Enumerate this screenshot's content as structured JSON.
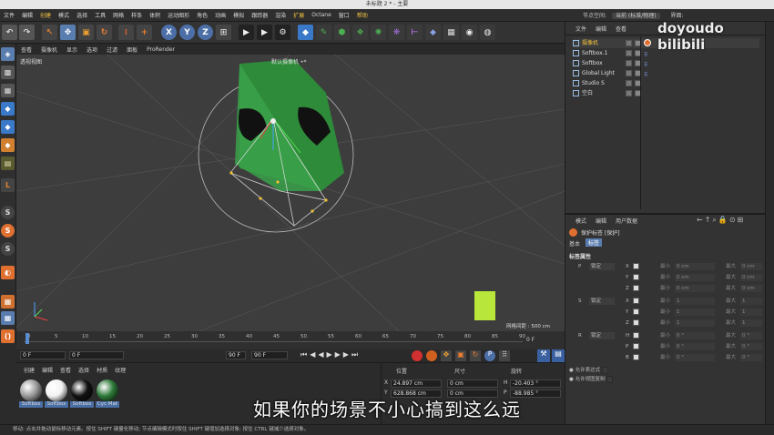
{
  "window": {
    "title": "未标题 2 * - 主要"
  },
  "menu": [
    {
      "label": "文件",
      "hl": false
    },
    {
      "label": "编辑",
      "hl": false
    },
    {
      "label": "创建",
      "hl": true
    },
    {
      "label": "模式",
      "hl": false
    },
    {
      "label": "选择",
      "hl": false
    },
    {
      "label": "工具",
      "hl": false
    },
    {
      "label": "网格",
      "hl": false
    },
    {
      "label": "样条",
      "hl": false
    },
    {
      "label": "体积",
      "hl": false
    },
    {
      "label": "运动图形",
      "hl": false
    },
    {
      "label": "角色",
      "hl": false
    },
    {
      "label": "动画",
      "hl": false
    },
    {
      "label": "模拟",
      "hl": false
    },
    {
      "label": "跟踪器",
      "hl": false
    },
    {
      "label": "渲染",
      "hl": false
    },
    {
      "label": "扩展",
      "hl": true
    },
    {
      "label": "Octane",
      "hl": false
    },
    {
      "label": "窗口",
      "hl": false
    },
    {
      "label": "帮助",
      "hl": true
    }
  ],
  "node_space": {
    "label": "节点空间:",
    "value": "当前 (标准/物理)",
    "layout_label": "界面:"
  },
  "toolbar": {
    "axis_x": "X",
    "axis_y": "Y",
    "axis_z": "Z"
  },
  "viewport_menu": [
    "查看",
    "摄像机",
    "显示",
    "选项",
    "过滤",
    "面板",
    "ProRender"
  ],
  "viewport": {
    "view_name": "透视视图",
    "camera_label": "默认摄像机 •*",
    "grid_spacing": "网格间距 : 500 cm"
  },
  "timeline": {
    "ticks": [
      "0",
      "5",
      "10",
      "15",
      "20",
      "25",
      "30",
      "35",
      "40",
      "45",
      "50",
      "55",
      "60",
      "65",
      "70",
      "75",
      "80",
      "85",
      "90"
    ],
    "end_frame": "0 F"
  },
  "transport": {
    "current": "0 F",
    "start": "0 F",
    "end": "90 F",
    "end2": "90 F"
  },
  "materials": {
    "menu": [
      "创建",
      "编辑",
      "查看",
      "选择",
      "材质",
      "纹理"
    ],
    "items": [
      {
        "name": "Softbox",
        "color": "#9a9a9a"
      },
      {
        "name": "Softbox",
        "color": "#f2f2f2"
      },
      {
        "name": "Softbox",
        "color": "#111111"
      },
      {
        "name": "Cyc Mat",
        "color": "#2f7a3a"
      }
    ]
  },
  "coords": {
    "headers": [
      "位置",
      "尺寸",
      "旋转"
    ],
    "rows": [
      {
        "axis": "X",
        "pos": "24.897 cm",
        "size": "0 cm",
        "rot_label": "H",
        "rot": "-20.403 °"
      },
      {
        "axis": "Y",
        "pos": "628.868 cm",
        "size": "0 cm",
        "rot_label": "P",
        "rot": "-88.985 °"
      }
    ]
  },
  "objects": {
    "menu": [
      "文件",
      "编辑",
      "查看"
    ],
    "items": [
      {
        "name": "摄像机",
        "selected": true
      },
      {
        "name": "Softbox.1",
        "selected": false
      },
      {
        "name": "Softbox",
        "selected": false
      },
      {
        "name": "Global Light",
        "selected": false
      },
      {
        "name": "Studio S",
        "selected": false
      },
      {
        "name": "空白",
        "selected": false
      }
    ]
  },
  "attributes": {
    "menu": [
      "模式",
      "编辑",
      "用户数据"
    ],
    "tag_title": "保护标签 [保护]",
    "tabs": [
      "基本",
      "标签"
    ],
    "section": "标签属性",
    "groups": [
      {
        "label": "P",
        "mode": "锁定",
        "axes": [
          "X",
          "Y",
          "Z"
        ],
        "min": "0 cm",
        "max": "0 cm"
      },
      {
        "label": "S",
        "mode": "锁定",
        "axes": [
          "X",
          "Y",
          "Z"
        ],
        "min": "1",
        "max": "1"
      },
      {
        "label": "R",
        "mode": "锁定",
        "axes": [
          "H",
          "P",
          "B"
        ],
        "min": "0 °",
        "max": "0 °"
      }
    ],
    "min_label": "最小",
    "max_label": "最大",
    "allow_expr": "允许表达式",
    "allow_view": "允许视图复制"
  },
  "status": "移动: 点击并拖动鼠标移动元素。按住 SHIFT 键量化移动; 节点编辑模式时按住 SHIFT 键增加选择对象; 按住 CTRL 键减少选择对象。",
  "subtitle": "如果你的场景不小心搞到这么远",
  "watermark": "doyoudo bilibili"
}
